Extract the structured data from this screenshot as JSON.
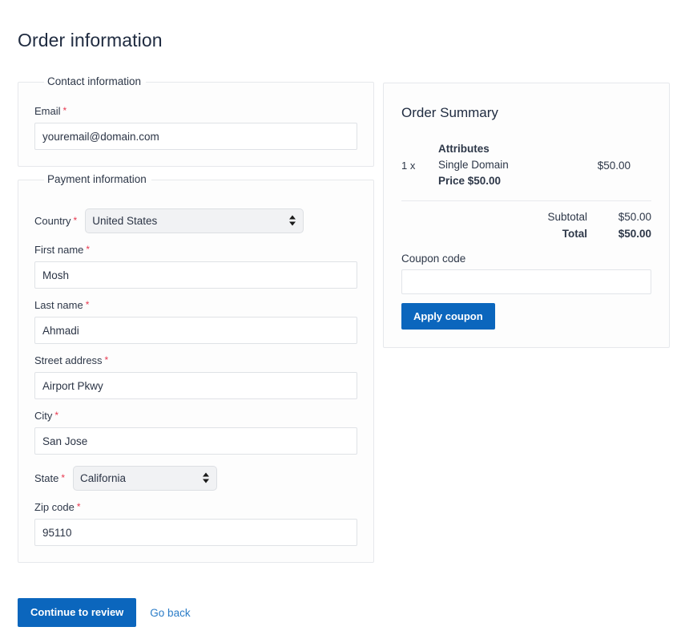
{
  "page": {
    "title": "Order information"
  },
  "contact": {
    "legend": "Contact information",
    "email": {
      "label": "Email",
      "required_mark": "*",
      "value": "youremail@domain.com",
      "placeholder": "youremail@domain.com"
    }
  },
  "payment": {
    "legend": "Payment information",
    "country": {
      "label": "Country",
      "required_mark": "*",
      "value": "United States"
    },
    "first_name": {
      "label": "First name",
      "required_mark": "*",
      "value": "Mosh",
      "placeholder": "First name"
    },
    "last_name": {
      "label": "Last name",
      "required_mark": "*",
      "value": "Ahmadi",
      "placeholder": "Last name"
    },
    "street_address": {
      "label": "Street address",
      "required_mark": "*",
      "value": "Airport Pkwy",
      "placeholder": "Street address"
    },
    "city": {
      "label": "City",
      "required_mark": "*",
      "value": "San Jose",
      "placeholder": "City"
    },
    "state": {
      "label": "State",
      "required_mark": "*",
      "value": "California"
    },
    "zip_code": {
      "label": "Zip code",
      "required_mark": "*",
      "value": "95110",
      "placeholder": "Zip code"
    }
  },
  "summary": {
    "title": "Order Summary",
    "items": [
      {
        "quantity": "1 x",
        "attributes_label": "Attributes",
        "name": "Single Domain",
        "price_label": "Price $50.00",
        "line_total": "$50.00"
      }
    ],
    "subtotal_label": "Subtotal",
    "subtotal_value": "$50.00",
    "total_label": "Total",
    "total_value": "$50.00",
    "coupon_label": "Coupon code",
    "coupon_value": "",
    "coupon_placeholder": "",
    "apply_coupon_label": "Apply coupon"
  },
  "actions": {
    "primary_label": "Continue to review",
    "secondary_label": "Go back"
  },
  "colors": {
    "primary_blue": "#0b66bd",
    "link_blue": "#2a7cc7",
    "required_red": "#e8384f",
    "text": "#2d3748",
    "border": "#e6e8ec"
  }
}
